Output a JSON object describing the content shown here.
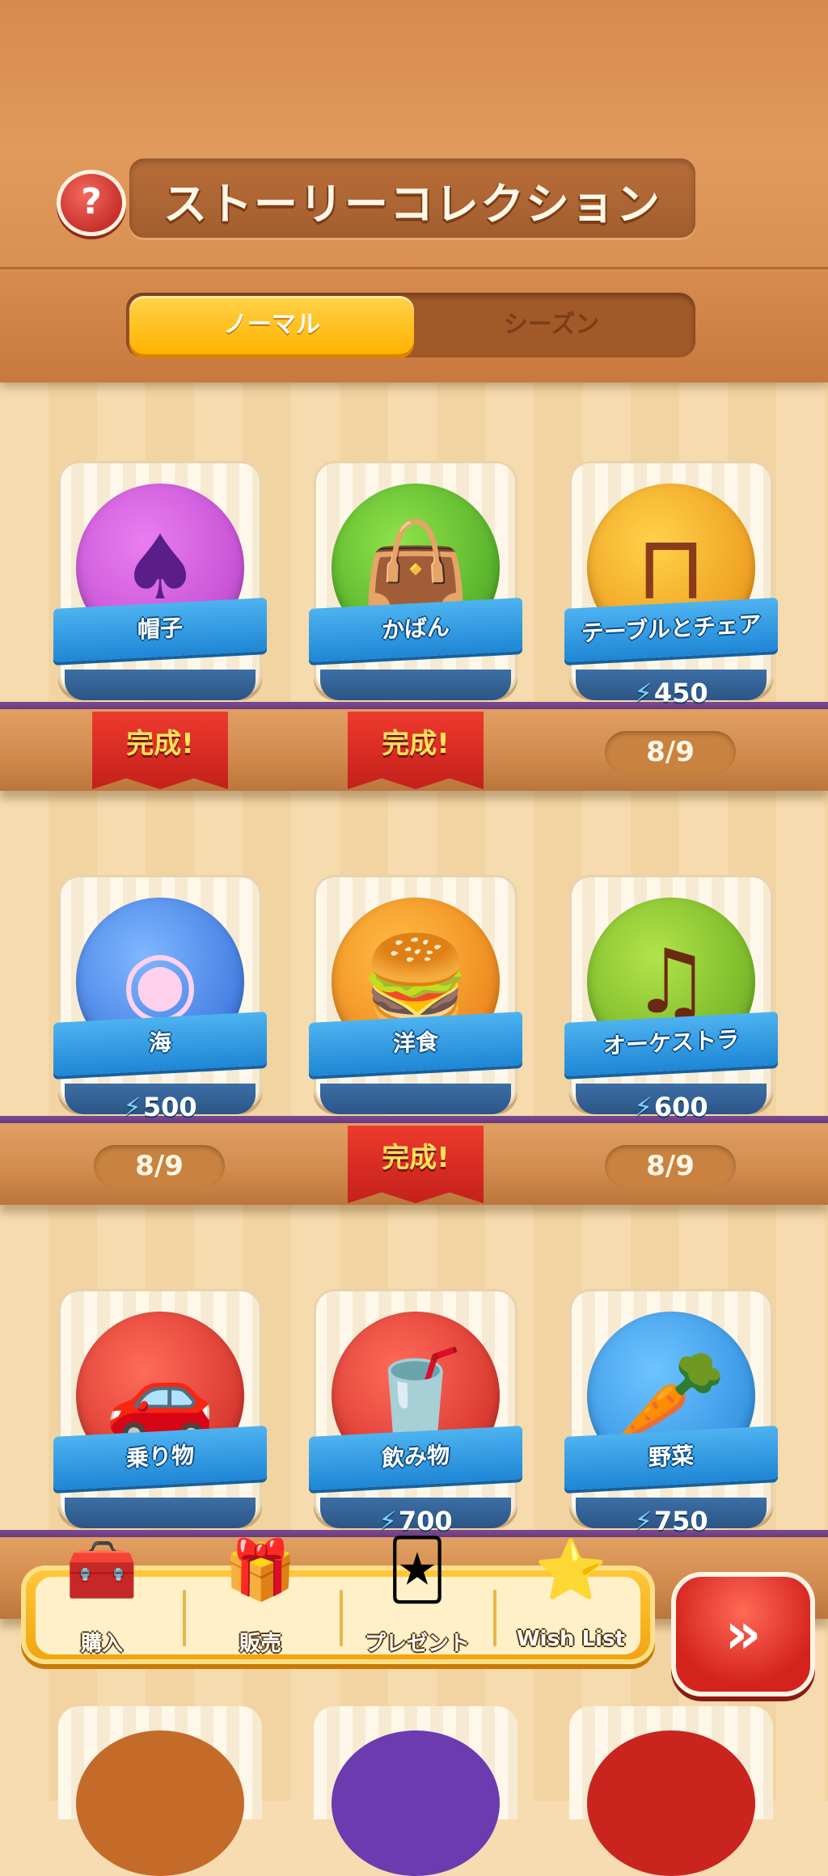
{
  "header": {
    "title": "ストーリーコレクション",
    "help_icon": "question-mark-icon"
  },
  "tabs": [
    {
      "label": "ノーマル",
      "active": true
    },
    {
      "label": "シーズン",
      "active": false
    }
  ],
  "cards": [
    {
      "label": "帽子",
      "status": "完成!",
      "cost": null,
      "icon": "top-hat-icon",
      "color": "#c94fd8"
    },
    {
      "label": "かばん",
      "status": "完成!",
      "cost": null,
      "icon": "green-handbag-icon",
      "color": "#54b52a"
    },
    {
      "label": "テーブルとチェア",
      "status": "8/9",
      "cost": "450",
      "icon": "table-icon",
      "color": "#f0a21a"
    },
    {
      "label": "海",
      "status": "8/9",
      "cost": "500",
      "icon": "pearl-shell-icon",
      "color": "#3b82e6"
    },
    {
      "label": "洋食",
      "status": "完成!",
      "cost": null,
      "icon": "hamburger-icon",
      "color": "#f08a16"
    },
    {
      "label": "オーケストラ",
      "status": "8/9",
      "cost": "600",
      "icon": "double-bass-icon",
      "color": "#7fc12c"
    },
    {
      "label": "乗り物",
      "status": null,
      "cost": null,
      "icon": "car-icon",
      "color": "#e2322a"
    },
    {
      "label": "飲み物",
      "status": null,
      "cost": "700",
      "icon": "cola-drink-icon",
      "color": "#e2322a"
    },
    {
      "label": "野菜",
      "status": null,
      "cost": "750",
      "icon": "vegetable-basket-icon",
      "color": "#2f9ce8"
    }
  ],
  "bottom_bar": [
    {
      "label": "購入",
      "icon": "treasure-chest-plus-icon"
    },
    {
      "label": "販売",
      "icon": "chest-sell-icon"
    },
    {
      "label": "プレゼント",
      "icon": "card-send-icon"
    },
    {
      "label": "Wish List",
      "icon": "card-star-icon"
    }
  ],
  "next_button": {
    "label": "»",
    "icon": "double-chevron-right-icon"
  }
}
